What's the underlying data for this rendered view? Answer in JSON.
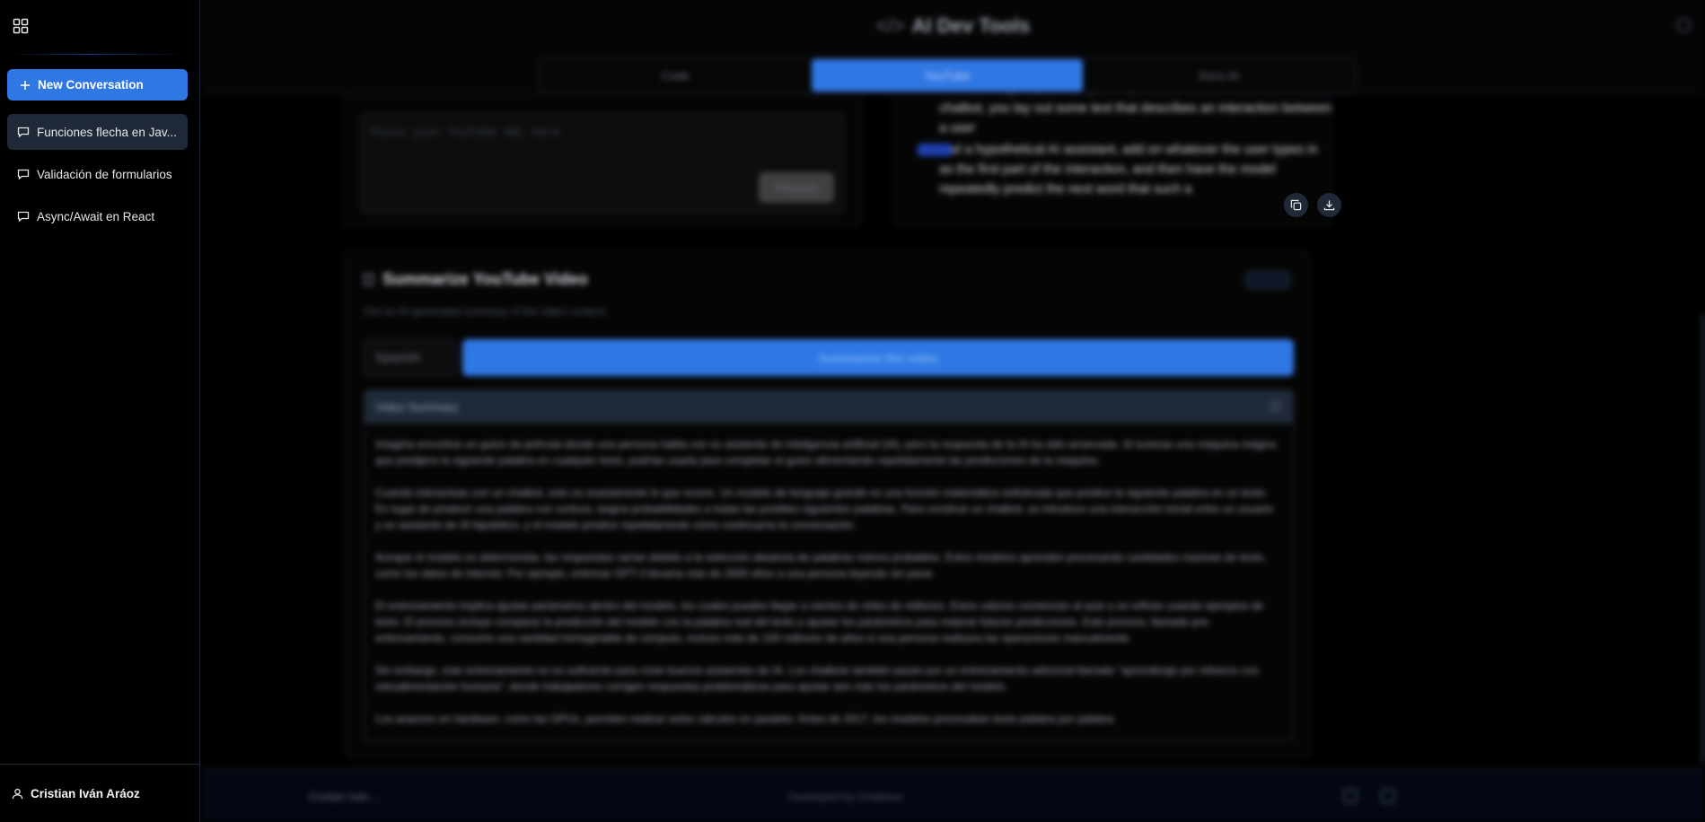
{
  "sidebar": {
    "new_conversation_label": "New Conversation",
    "conversations": [
      {
        "title": "Funciones flecha en JavaScript",
        "display": "Funciones flecha en Jav...",
        "active": true
      },
      {
        "title": "Validación de formularios",
        "display": "Validación de formularios",
        "active": false
      },
      {
        "title": "Async/Await en React",
        "display": "Async/Await en React",
        "active": false
      }
    ],
    "user_name": "Cristian Iván Aráoz"
  },
  "header": {
    "title": "AI Dev Tools",
    "tabs": [
      {
        "label": "Code",
        "active": false
      },
      {
        "label": "YouTube",
        "active": true
      },
      {
        "label": "Docs AI",
        "active": false
      }
    ]
  },
  "url_input": {
    "placeholder": "Paste your YouTube URL here",
    "process_label": "Process"
  },
  "transcript": {
    "lines": [
      "does is assign a probability to all possible next words. To build a chatbot, you lay out some text that describes an interaction between a user",
      "and a hypothetical AI assistant, add on whatever the user types in as the first part of the interaction, and then have the model repeatedly predict the next word that such a"
    ]
  },
  "summary": {
    "title": "Summarize YouTube Video",
    "subtitle": "Get an AI-generated summary of the video content",
    "full_label": "Full",
    "language": "Spanish",
    "button_label": "Summarize this video",
    "panel_title": "Video Summary",
    "paragraphs": [
      "Imagina encontrar un guion de película donde una persona habla con su asistente de inteligencia artificial (IA), pero la respuesta de la IA ha sido arrancada. Si tuvieras una máquina mágica que predijera la siguiente palabra en cualquier texto, podrías usarla para completar el guion alimentando repetidamente las predicciones de la máquina.",
      "Cuando interactúas con un chatbot, esto es exactamente lo que ocurre. Un modelo de lenguaje grande es una función matemática sofisticada que predice la siguiente palabra en un texto. En lugar de predecir una palabra con certeza, asigna probabilidades a todas las posibles siguientes palabras. Para construir un chatbot, se introduce una interacción inicial entre un usuario y un asistente de IA hipotético, y el modelo predice repetidamente cómo continuaría la conversación.",
      "Aunque el modelo es determinista, las respuestas varían debido a la selección aleatoria de palabras menos probables. Estos modelos aprenden procesando cantidades masivas de texto, como los datos de internet. Por ejemplo, entrenar GPT-3 llevaría más de 2600 años a una persona leyendo sin parar.",
      "El entrenamiento implica ajustar parámetros dentro del modelo, los cuales pueden llegar a cientos de miles de millones. Estos valores comienzan al azar y se refinan usando ejemplos de texto. El proceso incluye comparar la predicción del modelo con la palabra real del texto y ajustar los parámetros para mejorar futuras predicciones. Este proceso, llamado pre-entrenamiento, consume una cantidad inimaginable de cómputo, incluso más de 100 millones de años si una persona realizara las operaciones manualmente.",
      "Sin embargo, este entrenamiento no es suficiente para crear buenos asistentes de IA. Los chatbots también pasan por un entrenamiento adicional llamado \"aprendizaje por refuerzo con retroalimentación humana\", donde trabajadores corrigen respuestas problemáticas para ajustar aún más los parámetros del modelo.",
      "Los avances en hardware, como las GPUs, permiten realizar estos cálculos en paralelo. Antes de 2017, los modelos procesaban texto palabra por palabra."
    ]
  },
  "footer": {
    "user_short": "Cristian Iván ...",
    "credit": "Developed by Chatbase"
  }
}
